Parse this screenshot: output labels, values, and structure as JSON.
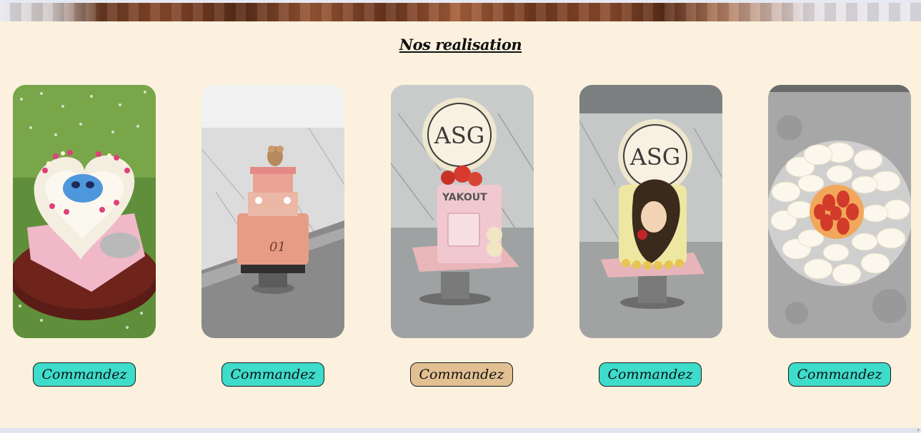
{
  "section": {
    "title": "Nos realisation"
  },
  "cards": [
    {
      "photo": "Stitch heart cake on table in grass",
      "button_label": "Commandez",
      "button_color": "#3ddccb"
    },
    {
      "photo": "Pink carousel tiered cake",
      "button_label": "Commandez",
      "button_color": "#3ddccb"
    },
    {
      "photo": "Perfume bottle cake with roses",
      "button_label": "Commandez",
      "button_color": "#e2c092"
    },
    {
      "photo": "Belle princess cake",
      "button_label": "Commandez",
      "button_color": "#3ddccb"
    },
    {
      "photo": "Strawberry cream flower cake",
      "button_label": "Commandez",
      "button_color": "#3ddccb"
    }
  ],
  "logo_text": "ASG",
  "cake_texts": [
    "YAKOUT",
    "01"
  ]
}
